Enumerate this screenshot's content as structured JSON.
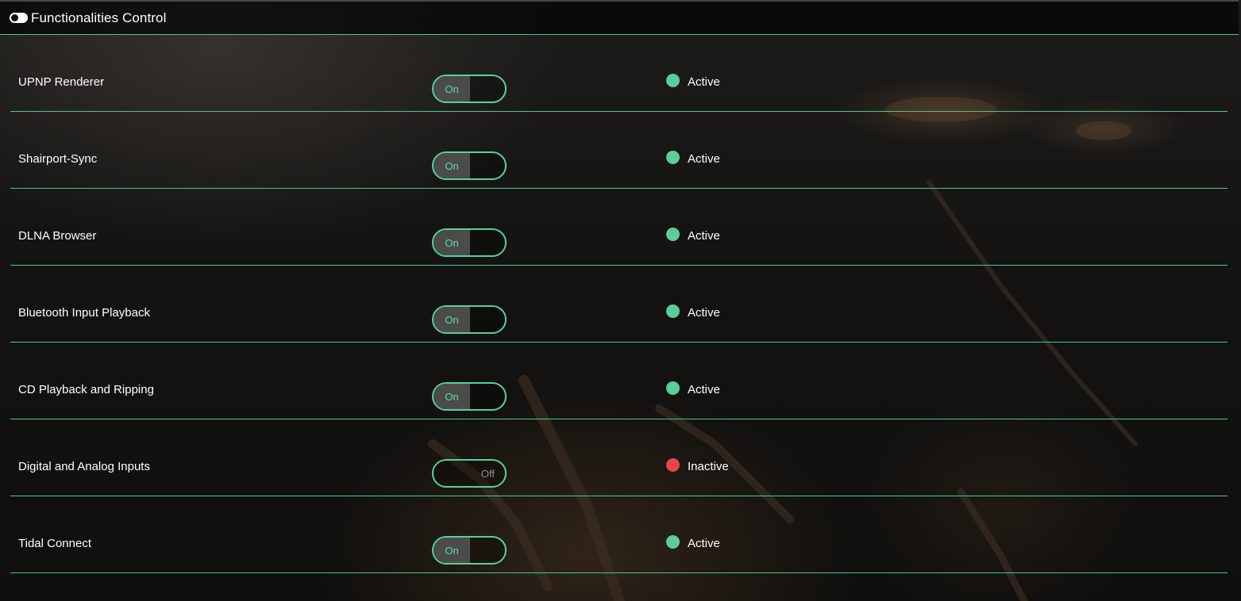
{
  "header": {
    "icon": "toggle-icon",
    "title": "Functionalities Control"
  },
  "colors": {
    "accent": "#46c98c",
    "active": "#5acd99",
    "inactive": "#e9464a"
  },
  "rows": [
    {
      "label": "UPNP Renderer",
      "switch_text": "On",
      "state": "on",
      "status": "Active"
    },
    {
      "label": "Shairport-Sync",
      "switch_text": "On",
      "state": "on",
      "status": "Active"
    },
    {
      "label": "DLNA Browser",
      "switch_text": "On",
      "state": "on",
      "status": "Active"
    },
    {
      "label": "Bluetooth Input Playback",
      "switch_text": "On",
      "state": "on",
      "status": "Active"
    },
    {
      "label": "CD Playback and Ripping",
      "switch_text": "On",
      "state": "on",
      "status": "Active"
    },
    {
      "label": "Digital and Analog Inputs",
      "switch_text": "Off",
      "state": "off",
      "status": "Inactive"
    },
    {
      "label": "Tidal Connect",
      "switch_text": "On",
      "state": "on",
      "status": "Active"
    }
  ]
}
